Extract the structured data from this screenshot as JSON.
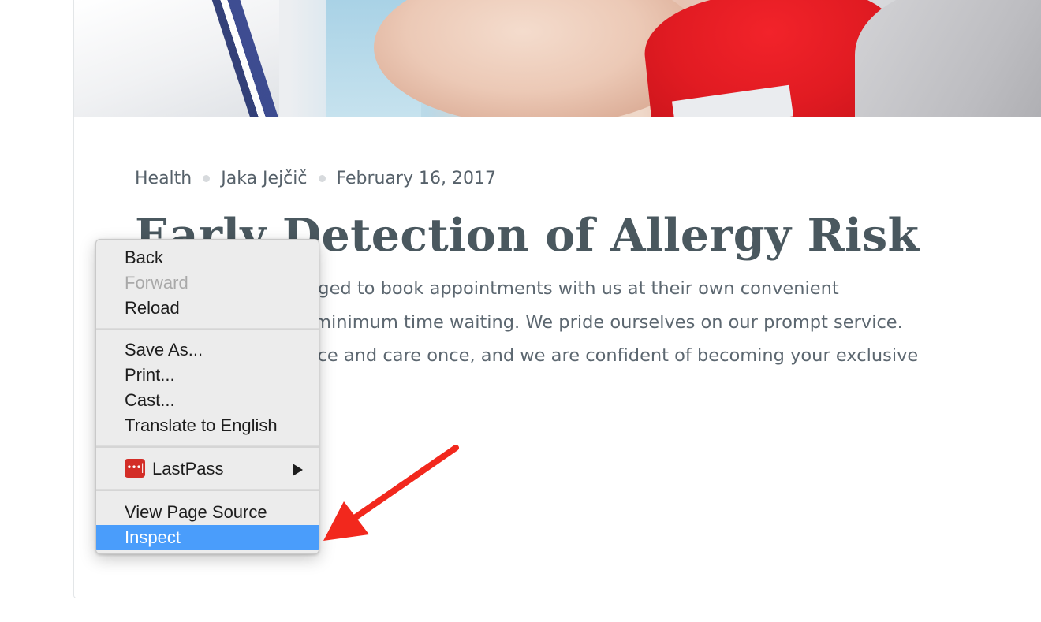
{
  "article": {
    "category": "Health",
    "author": "Jaka Jejčič",
    "date": "February 16, 2017",
    "title": "Early Detection of Allergy Risk",
    "body_lines": [
      "Patients are encouraged to book appointments with us at their own convenient",
      "time and spend the minimum time waiting. We pride ourselves on our prompt service.",
      "Try our friendly service and care once, and we are confident of becoming your exclusive"
    ]
  },
  "context_menu": {
    "back": "Back",
    "forward": "Forward",
    "reload": "Reload",
    "save_as": "Save As...",
    "print": "Print...",
    "cast": "Cast...",
    "translate": "Translate to English",
    "lastpass": "LastPass",
    "lastpass_icon": "•••|",
    "view_source": "View Page Source",
    "inspect": "Inspect"
  },
  "colors": {
    "highlight": "#4a9dfb",
    "annotation_arrow": "#f2281d",
    "lastpass_brand": "#d32d27"
  },
  "icons": {
    "lastpass": "lastpass-icon",
    "submenu": "submenu-arrow-icon",
    "annotation": "red-arrow-icon"
  }
}
